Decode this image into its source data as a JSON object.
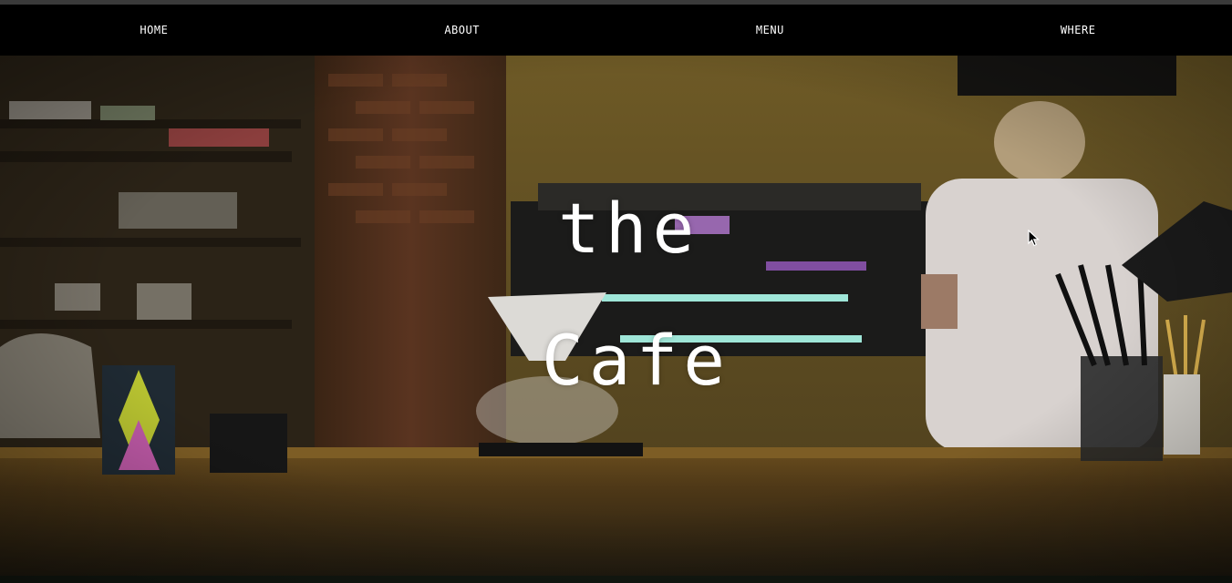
{
  "nav": {
    "items": [
      {
        "label": "HOME"
      },
      {
        "label": "ABOUT"
      },
      {
        "label": "MENU"
      },
      {
        "label": "WHERE"
      }
    ]
  },
  "hero": {
    "title_line1": "the",
    "title_line2": "Cafe",
    "image": "cafe-counter-photo"
  },
  "colors": {
    "nav_bg": "#000000",
    "nav_text": "#ffffff",
    "title_text": "#ffffff"
  }
}
